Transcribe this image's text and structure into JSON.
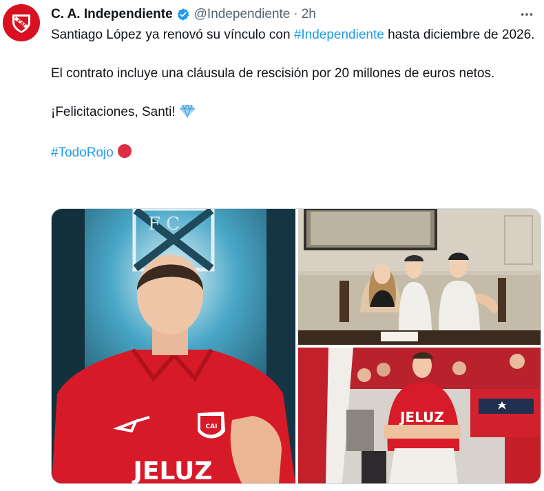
{
  "tweet": {
    "display_name": "C. A. Independiente",
    "handle": "@Independiente",
    "separator": "·",
    "time": "2h",
    "text_1a": "Santiago López ya renovó su vínculo con ",
    "hashtag_1": "#Independiente",
    "text_1b": " hasta diciembre de 2026.",
    "text_2": "El contrato incluye una cláusula de rescisión por 20 millones de euros netos.",
    "text_3": "¡Felicitaciones, Santi! ",
    "hashtag_2": "#TodoRojo",
    "emoji_3": "gem-emoji",
    "emoji_4": "red-circle-emoji"
  },
  "media": {
    "photo_1": {
      "badge_text": "CAI",
      "shirt_text": "JELUZ",
      "sign_letters": "FC"
    },
    "photo_3": {
      "shirt_text": "JELUZ"
    }
  },
  "colors": {
    "brand_red": "#d8101f",
    "link": "#1d9bf0",
    "verified": "#1d9bf0",
    "muted": "#536471"
  },
  "icons": [
    "club-crest-icon",
    "verified-badge-icon",
    "more-options-icon"
  ]
}
